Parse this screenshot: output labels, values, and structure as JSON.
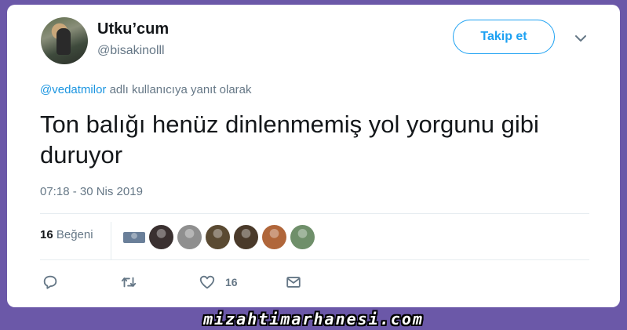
{
  "tweet": {
    "display_name": "Utku’cum",
    "handle": "@bisakinolll",
    "follow_label": "Takip et",
    "reply_mention": "@vedatmilor",
    "reply_suffix": " adlı kullanıcıya yanıt olarak",
    "text": "Ton balığı henüz dinlenmemiş yol yorgunu gibi duruyor",
    "timestamp": "07:18 - 30 Nis 2019",
    "likes_number": "16",
    "likes_word": " Beğeni",
    "like_action_count": "16"
  },
  "likers": [
    {
      "name": "liker-avatar-1",
      "color": "#6a7f99"
    },
    {
      "name": "liker-avatar-2",
      "color": "#3a3030"
    },
    {
      "name": "liker-avatar-3",
      "color": "#8f8f8f"
    },
    {
      "name": "liker-avatar-4",
      "color": "#5a4a32"
    },
    {
      "name": "liker-avatar-5",
      "color": "#4a3a2a"
    },
    {
      "name": "liker-avatar-6",
      "color": "#b0663a"
    },
    {
      "name": "liker-avatar-7",
      "color": "#6f8f6a"
    }
  ],
  "icons": {
    "chevron": "chevron-down-icon",
    "reply": "reply-icon",
    "retweet": "retweet-icon",
    "like": "heart-icon",
    "message": "envelope-icon"
  },
  "colors": {
    "background": "#6b58a8",
    "accent": "#1da1f2",
    "text": "#14171a",
    "muted": "#657786"
  },
  "watermark": "mizahtimarhanesi.com"
}
